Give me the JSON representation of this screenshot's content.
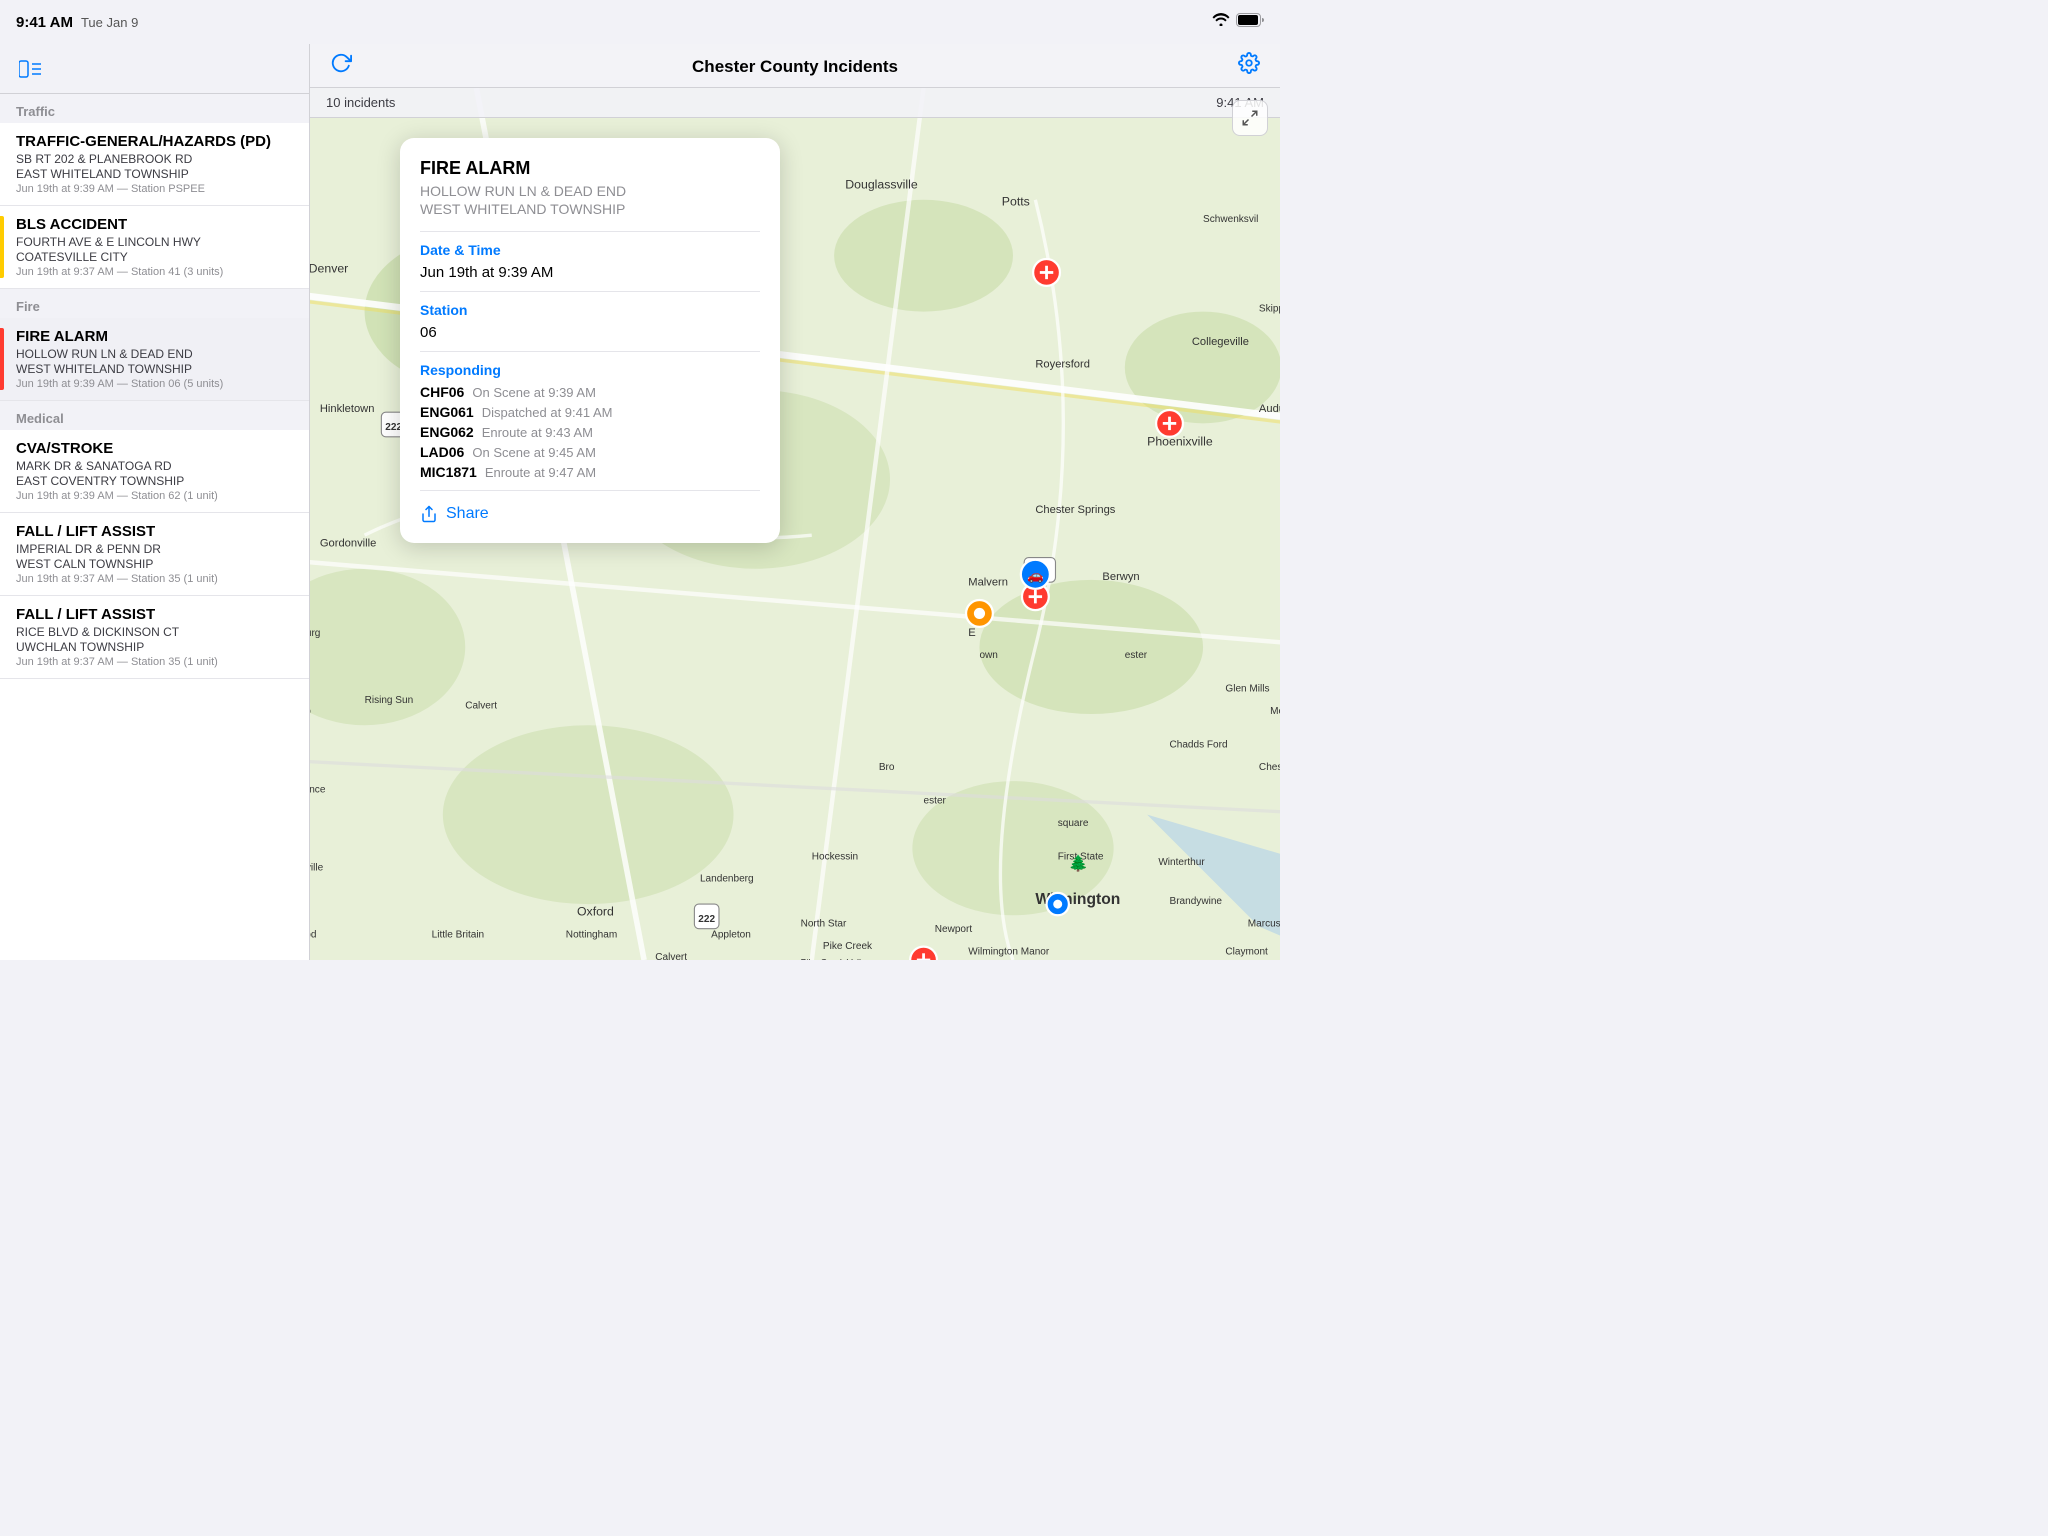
{
  "statusBar": {
    "time": "9:41 AM",
    "date": "Tue Jan 9",
    "timeRight": "9:41 AM"
  },
  "sidebar": {
    "toggleLabel": "Toggle Sidebar",
    "sections": [
      {
        "label": "Traffic",
        "incidents": [
          {
            "title": "TRAFFIC-GENERAL/HAZARDS (PD)",
            "address": "SB RT 202 & PLANEBROOK RD",
            "township": "EAST WHITELAND TOWNSHIP",
            "meta": "Jun 19th at 9:39 AM — Station PSPEE",
            "priority": null,
            "selected": false
          }
        ]
      },
      {
        "label": "",
        "incidents": [
          {
            "title": "BLS ACCIDENT",
            "address": "FOURTH AVE & E LINCOLN HWY",
            "township": "COATESVILLE CITY",
            "meta": "Jun 19th at 9:37 AM — Station 41 (3 units)",
            "priority": "yellow",
            "selected": false
          }
        ]
      },
      {
        "label": "Fire",
        "incidents": [
          {
            "title": "FIRE ALARM",
            "address": "HOLLOW RUN LN & DEAD END",
            "township": "WEST WHITELAND TOWNSHIP",
            "meta": "Jun 19th at 9:39 AM — Station 06 (5 units)",
            "priority": "red",
            "selected": true
          }
        ]
      },
      {
        "label": "Medical",
        "incidents": [
          {
            "title": "CVA/STROKE",
            "address": "MARK DR & SANATOGA RD",
            "township": "EAST COVENTRY TOWNSHIP",
            "meta": "Jun 19th at 9:39 AM — Station 62 (1 unit)",
            "priority": null,
            "selected": false
          },
          {
            "title": "FALL / LIFT ASSIST",
            "address": "IMPERIAL DR & PENN DR",
            "township": "WEST CALN TOWNSHIP",
            "meta": "Jun 19th at 9:37 AM — Station 35 (1 unit)",
            "priority": null,
            "selected": false
          },
          {
            "title": "FALL / LIFT ASSIST",
            "address": "RICE BLVD & DICKINSON CT",
            "township": "UWCHLAN TOWNSHIP",
            "meta": "Jun 19th at 9:37 AM — Station 35 (1 unit)",
            "priority": null,
            "selected": false
          }
        ]
      }
    ]
  },
  "navbar": {
    "title": "Chester County Incidents",
    "refreshLabel": "Refresh",
    "settingsLabel": "Settings"
  },
  "incidentsBar": {
    "count": "10 incidents",
    "time": "9:41 AM"
  },
  "popup": {
    "title": "FIRE ALARM",
    "address": "HOLLOW RUN LN & DEAD END",
    "township": "WEST WHITELAND TOWNSHIP",
    "dateTimeLabel": "Date & Time",
    "dateTimeValue": "Jun 19th at 9:39 AM",
    "stationLabel": "Station",
    "stationValue": "06",
    "respondingLabel": "Responding",
    "units": [
      {
        "name": "CHF06",
        "status": "On Scene at 9:39 AM"
      },
      {
        "name": "ENG061",
        "status": "Dispatched at 9:41 AM"
      },
      {
        "name": "ENG062",
        "status": "Enroute at 9:43 AM"
      },
      {
        "name": "LAD06",
        "status": "On Scene at 9:45 AM"
      },
      {
        "name": "MIC1871",
        "status": "Enroute at 9:47 AM"
      }
    ],
    "shareLabel": "Share"
  }
}
